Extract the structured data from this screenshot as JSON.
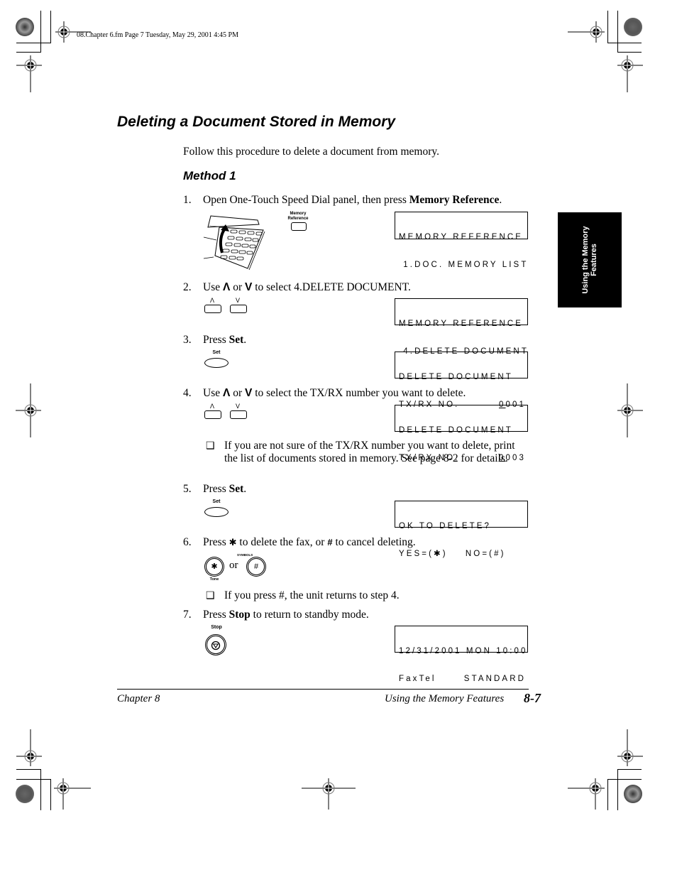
{
  "header": {
    "slug": "08.Chapter 6.fm  Page 7  Tuesday, May 29, 2001  4:45 PM"
  },
  "section_title": "Deleting a Document Stored in Memory",
  "intro": "Follow this procedure to delete a document from memory.",
  "method_title": "Method 1",
  "side_tab": {
    "line1": "Using the Memory",
    "line2": "Features"
  },
  "steps": [
    {
      "num": "1.",
      "pre": "Open One-Touch Speed Dial panel, then press ",
      "bold": "Memory Reference",
      "post": ".",
      "key_label_1": "Memory",
      "key_label_2": "Reference",
      "lcd": [
        "MEMORY REFERENCE",
        " 1.DOC. MEMORY LIST"
      ]
    },
    {
      "num": "2.",
      "pre": "Use ",
      "up": "Λ",
      "mid": " or ",
      "down": "V",
      "post": " to select 4.DELETE DOCUMENT.",
      "key_up": "Λ",
      "key_down": "V",
      "lcd": [
        "MEMORY REFERENCE",
        " 4.DELETE DOCUMENT"
      ]
    },
    {
      "num": "3.",
      "pre": "Press ",
      "bold": "Set",
      "post": ".",
      "key_label": "Set",
      "lcd": [
        "DELETE DOCUMENT",
        "TX/RX NO."
      ],
      "lcd_value_cursor": "0",
      "lcd_value_rest": "001"
    },
    {
      "num": "4.",
      "pre": "Use ",
      "up": "Λ",
      "mid": " or ",
      "down": "V",
      "post": " to select the TX/RX number you want to delete.",
      "key_up": "Λ",
      "key_down": "V",
      "lcd": [
        "DELETE DOCUMENT",
        "TX/RX NO."
      ],
      "lcd_value_cursor": "0",
      "lcd_value_rest": "003",
      "note_bullet": "❑",
      "note": "If you are not sure of the TX/RX number you want to delete, print the list of documents stored in memory. See page 8-2 for details."
    },
    {
      "num": "5.",
      "pre": "Press ",
      "bold": "Set",
      "post": ".",
      "key_label": "Set",
      "lcd": [
        "OK TO DELETE?",
        "YES=(✱)    NO=(#)"
      ]
    },
    {
      "num": "6.",
      "pre": "Press ",
      "star": "✱",
      "mid": " to delete the fax, or ",
      "hash": "#",
      "post": " to cancel deleting.",
      "star_key": "✱",
      "star_key_label": "Tone",
      "or_text": "or",
      "hash_key": "#",
      "hash_key_label": "SYMBOLS",
      "note_bullet": "❑",
      "note": "If you press #, the unit returns to step 4."
    },
    {
      "num": "7.",
      "pre": "Press ",
      "bold": "Stop",
      "post": " to return to standby mode.",
      "key_label": "Stop",
      "lcd": [
        "12/31/2001 MON 10:00",
        "FaxTel"
      ],
      "lcd_value_rest": "STANDARD"
    }
  ],
  "footer": {
    "chapter": "Chapter 8",
    "section": "Using the Memory Features",
    "page": "8-7"
  }
}
